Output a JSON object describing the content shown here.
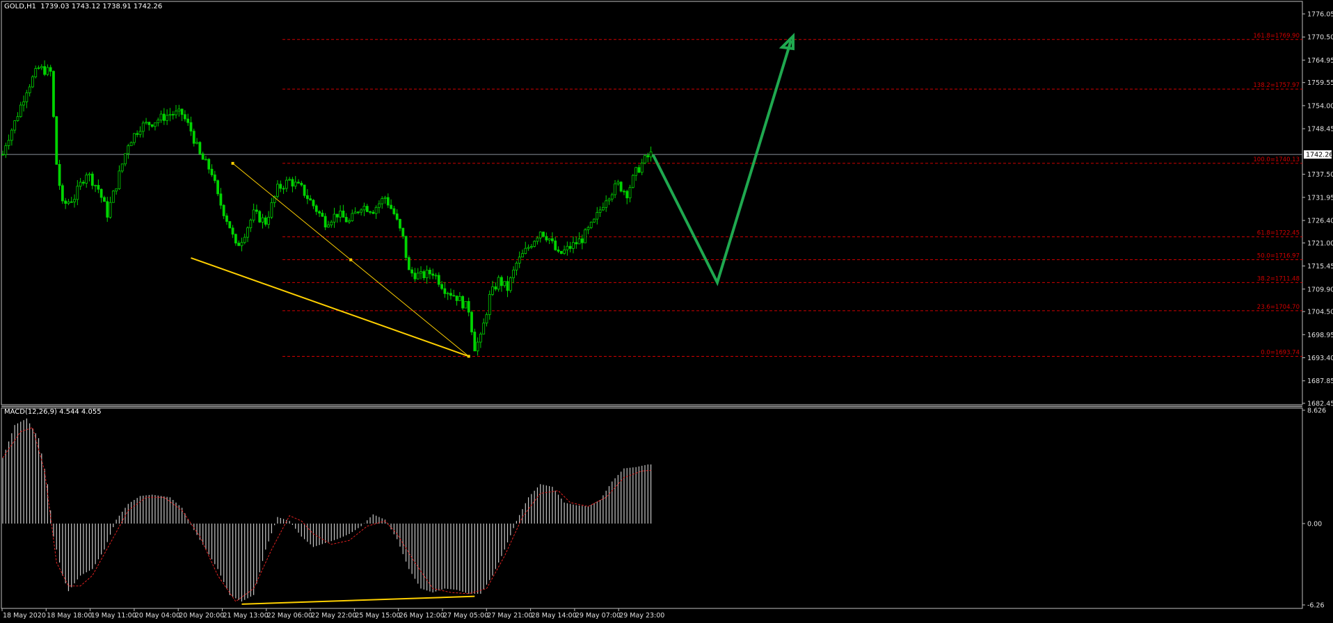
{
  "price_panel": {
    "header": "GOLD,H1  1739.03 1743.12 1738.91 1742.26",
    "current_price_label": "1742.26",
    "current_price": 1742.26,
    "y_ticks": [
      "1776.05",
      "1770.50",
      "1764.95",
      "1759.55",
      "1754.00",
      "1748.45",
      "1742.26",
      "1737.50",
      "1731.95",
      "1726.40",
      "1721.00",
      "1715.45",
      "1709.90",
      "1704.50",
      "1698.95",
      "1693.40",
      "1687.85",
      "1682.45"
    ],
    "ylim": [
      1682.45,
      1778.5
    ]
  },
  "macd_panel": {
    "header": "MACD(12,26,9) 4.544 4.055",
    "y_ticks": [
      "8.626",
      "0.00",
      "-6.26"
    ],
    "ylim": [
      -6.26,
      8.626
    ]
  },
  "x_ticks": [
    "18 May 2020",
    "18 May 18:00",
    "19 May 11:00",
    "20 May 04:00",
    "20 May 20:00",
    "21 May 13:00",
    "22 May 06:00",
    "22 May 22:00",
    "25 May 15:00",
    "26 May 12:00",
    "27 May 05:00",
    "27 May 21:00",
    "28 May 14:00",
    "29 May 07:00",
    "29 May 23:00"
  ],
  "fib_levels": [
    {
      "label": "161.8=1769.90",
      "value": 1769.9
    },
    {
      "label": "138.2=1757.97",
      "value": 1757.97
    },
    {
      "label": "100.0=1740.13",
      "value": 1740.13
    },
    {
      "label": "61.8=1722.45",
      "value": 1722.45
    },
    {
      "label": "50.0=1716.97",
      "value": 1716.97
    },
    {
      "label": "38.2=1711.48",
      "value": 1711.48
    },
    {
      "label": "23.6=1704.70",
      "value": 1704.7
    },
    {
      "label": "0.0=1693.74",
      "value": 1693.74
    }
  ],
  "colors": {
    "candle": "#00d400",
    "fib": "#d10000",
    "trendline": "#ffd000",
    "forecast": "#1fa84f",
    "macd_hist": "#c8c8c8",
    "macd_signal": "#e02020",
    "axis": "#c0c0c0"
  },
  "chart_data": {
    "type": "candlestick",
    "symbol": "GOLD",
    "timeframe": "H1",
    "price_path": [
      [
        1,
        1745
      ],
      [
        4,
        1750
      ],
      [
        8,
        1758
      ],
      [
        12,
        1763
      ],
      [
        16,
        1762
      ],
      [
        18,
        1740
      ],
      [
        20,
        1730
      ],
      [
        24,
        1732
      ],
      [
        28,
        1738
      ],
      [
        32,
        1734
      ],
      [
        35,
        1728
      ],
      [
        38,
        1735
      ],
      [
        42,
        1745
      ],
      [
        46,
        1749
      ],
      [
        50,
        1750
      ],
      [
        56,
        1752
      ],
      [
        60,
        1752
      ],
      [
        63,
        1748
      ],
      [
        66,
        1742
      ],
      [
        70,
        1738
      ],
      [
        72,
        1732
      ],
      [
        76,
        1725
      ],
      [
        78,
        1720
      ],
      [
        80,
        1722
      ],
      [
        84,
        1728
      ],
      [
        88,
        1726
      ],
      [
        92,
        1734
      ],
      [
        96,
        1736
      ],
      [
        100,
        1734
      ],
      [
        104,
        1730
      ],
      [
        108,
        1726
      ],
      [
        112,
        1728
      ],
      [
        116,
        1726
      ],
      [
        120,
        1730
      ],
      [
        124,
        1729
      ],
      [
        128,
        1732
      ],
      [
        131,
        1728
      ],
      [
        134,
        1722
      ],
      [
        136,
        1714
      ],
      [
        140,
        1713
      ],
      [
        144,
        1714
      ],
      [
        148,
        1710
      ],
      [
        152,
        1708
      ],
      [
        156,
        1705
      ],
      [
        158,
        1696
      ],
      [
        160,
        1698
      ],
      [
        163,
        1708
      ],
      [
        166,
        1712
      ],
      [
        169,
        1710
      ],
      [
        172,
        1716
      ],
      [
        176,
        1720
      ],
      [
        180,
        1724
      ],
      [
        183,
        1722
      ],
      [
        186,
        1718
      ],
      [
        190,
        1720
      ],
      [
        194,
        1722
      ],
      [
        198,
        1726
      ],
      [
        202,
        1732
      ],
      [
        206,
        1735
      ],
      [
        209,
        1733
      ],
      [
        212,
        1738
      ],
      [
        215,
        1741
      ],
      [
        217,
        1742.26
      ]
    ],
    "bar_count": 218,
    "macd": {
      "histogram_path": [
        [
          0,
          5.0
        ],
        [
          4,
          7.5
        ],
        [
          8,
          8.0
        ],
        [
          12,
          6.5
        ],
        [
          15,
          3.0
        ],
        [
          17,
          -1.0
        ],
        [
          20,
          -4.0
        ],
        [
          22,
          -5.2
        ],
        [
          26,
          -4.0
        ],
        [
          30,
          -3.5
        ],
        [
          34,
          -2.0
        ],
        [
          38,
          0.3
        ],
        [
          42,
          1.5
        ],
        [
          46,
          2.1
        ],
        [
          50,
          2.2
        ],
        [
          56,
          2.0
        ],
        [
          60,
          1.2
        ],
        [
          64,
          -0.5
        ],
        [
          68,
          -2.0
        ],
        [
          72,
          -3.5
        ],
        [
          76,
          -5.5
        ],
        [
          80,
          -6.0
        ],
        [
          84,
          -5.5
        ],
        [
          88,
          -2.0
        ],
        [
          92,
          0.5
        ],
        [
          96,
          0.2
        ],
        [
          100,
          -1.0
        ],
        [
          104,
          -1.8
        ],
        [
          108,
          -1.5
        ],
        [
          112,
          -1.2
        ],
        [
          116,
          -0.8
        ],
        [
          120,
          -0.2
        ],
        [
          124,
          0.7
        ],
        [
          128,
          0.3
        ],
        [
          132,
          -1.2
        ],
        [
          136,
          -3.5
        ],
        [
          140,
          -5.0
        ],
        [
          144,
          -5.3
        ],
        [
          148,
          -5.0
        ],
        [
          152,
          -5.1
        ],
        [
          156,
          -5.4
        ],
        [
          160,
          -5.4
        ],
        [
          164,
          -4.0
        ],
        [
          168,
          -2.0
        ],
        [
          172,
          0.2
        ],
        [
          176,
          2.0
        ],
        [
          180,
          3.0
        ],
        [
          184,
          2.8
        ],
        [
          188,
          1.6
        ],
        [
          192,
          1.4
        ],
        [
          196,
          1.3
        ],
        [
          200,
          1.8
        ],
        [
          204,
          3.2
        ],
        [
          208,
          4.2
        ],
        [
          212,
          4.3
        ],
        [
          216,
          4.5
        ]
      ],
      "signal_path": [
        [
          0,
          5.0
        ],
        [
          6,
          7.0
        ],
        [
          10,
          7.3
        ],
        [
          14,
          4.0
        ],
        [
          18,
          -3.0
        ],
        [
          22,
          -4.8
        ],
        [
          26,
          -4.8
        ],
        [
          30,
          -4.0
        ],
        [
          36,
          -1.5
        ],
        [
          42,
          1.0
        ],
        [
          48,
          2.0
        ],
        [
          54,
          2.0
        ],
        [
          60,
          1.0
        ],
        [
          66,
          -1.0
        ],
        [
          72,
          -4.0
        ],
        [
          78,
          -6.0
        ],
        [
          84,
          -5.0
        ],
        [
          90,
          -2.0
        ],
        [
          96,
          0.6
        ],
        [
          100,
          0.2
        ],
        [
          104,
          -0.8
        ],
        [
          110,
          -1.6
        ],
        [
          116,
          -1.3
        ],
        [
          122,
          -0.2
        ],
        [
          128,
          0.2
        ],
        [
          132,
          -0.8
        ],
        [
          138,
          -3.0
        ],
        [
          144,
          -5.0
        ],
        [
          150,
          -5.3
        ],
        [
          156,
          -5.4
        ],
        [
          162,
          -5.0
        ],
        [
          168,
          -2.5
        ],
        [
          174,
          0.5
        ],
        [
          180,
          2.3
        ],
        [
          186,
          2.5
        ],
        [
          190,
          1.6
        ],
        [
          196,
          1.3
        ],
        [
          202,
          2.0
        ],
        [
          208,
          3.5
        ],
        [
          214,
          4.0
        ],
        [
          217,
          4.055
        ]
      ]
    }
  }
}
